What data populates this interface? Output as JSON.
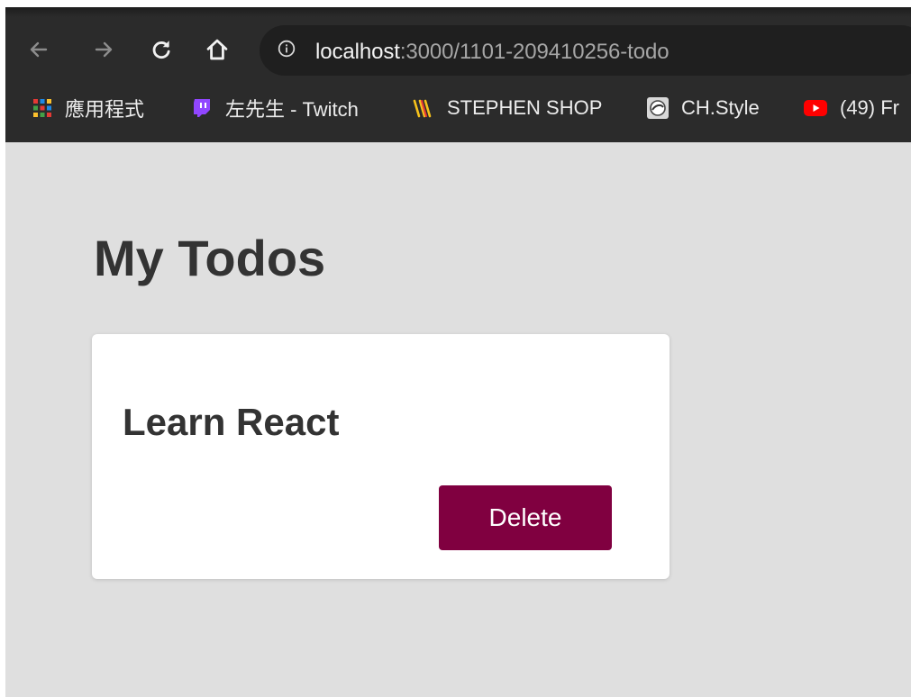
{
  "browser": {
    "url_host": "localhost",
    "url_path": ":3000/1101-209410256-todo",
    "bookmarks": [
      {
        "label": "應用程式",
        "icon": "apps-grid-icon"
      },
      {
        "label": "左先生 - Twitch",
        "icon": "twitch-icon"
      },
      {
        "label": "STEPHEN SHOP",
        "icon": "stephen-shop-icon"
      },
      {
        "label": "CH.Style",
        "icon": "ch-style-icon"
      },
      {
        "label": "(49) Fr",
        "icon": "youtube-icon"
      }
    ]
  },
  "page": {
    "title": "My Todos",
    "todos": [
      {
        "text": "Learn React",
        "delete_label": "Delete"
      }
    ]
  },
  "colors": {
    "page_bg": "#dfdfdf",
    "card_bg": "#ffffff",
    "delete_button": "#800040",
    "text": "#333333",
    "browser_chrome": "#2b2b2b"
  }
}
